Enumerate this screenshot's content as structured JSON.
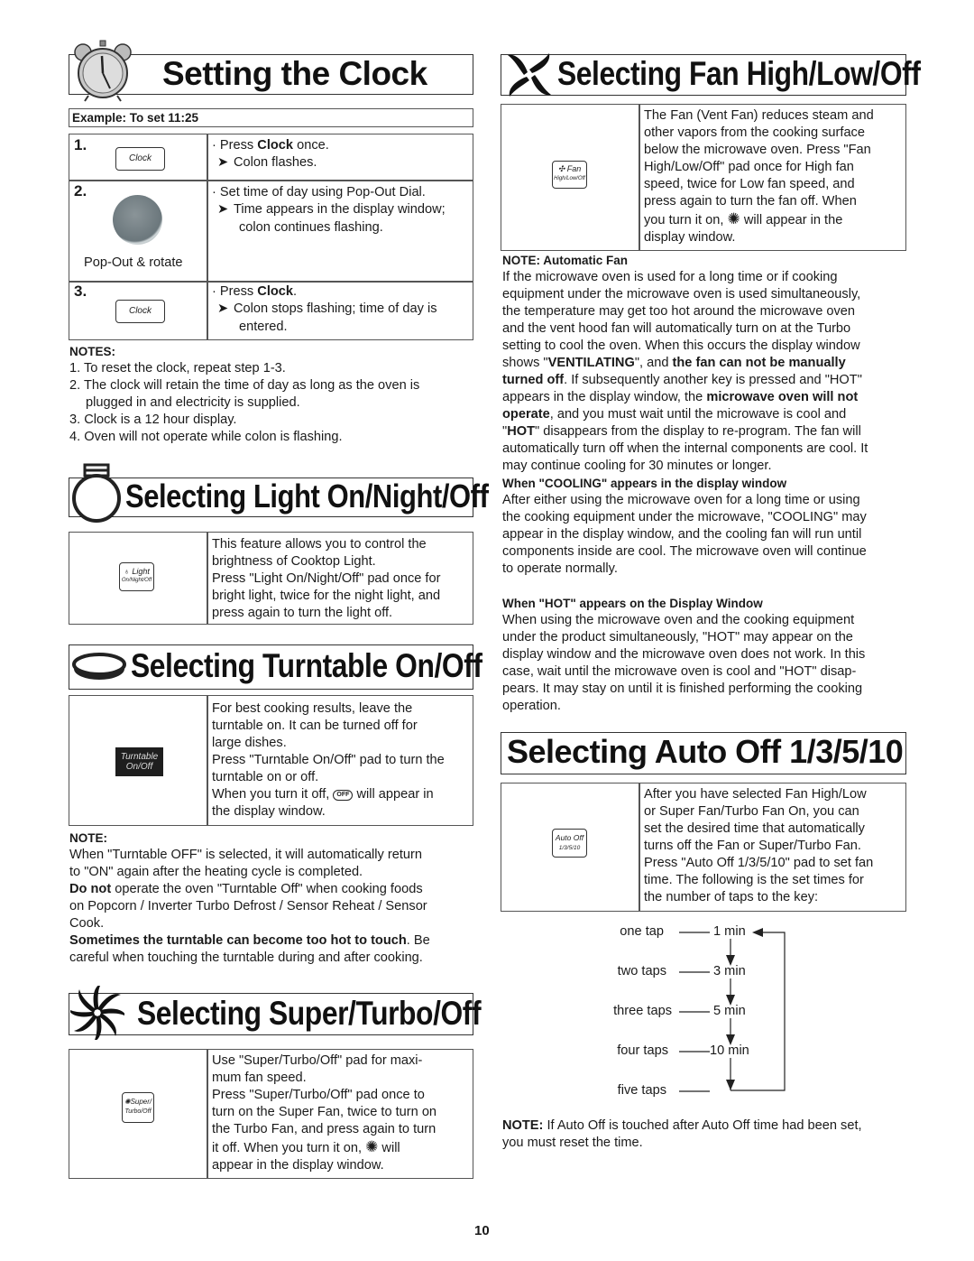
{
  "page_number": "10",
  "clock": {
    "title": "Setting the Clock",
    "icon": "alarm-clock-icon",
    "example": "Example: To set 11:25",
    "steps": [
      {
        "num": "1.",
        "pad": "Clock",
        "bullet_pre": "Press ",
        "bullet_bold": "Clock",
        "bullet_post": " once.",
        "result": [
          "Colon flashes."
        ]
      },
      {
        "num": "2.",
        "dial_label": "Pop-Out & rotate",
        "bullet_pre": "Set time of day using Pop-Out Dial.",
        "bullet_bold": "",
        "bullet_post": "",
        "result": [
          "Time appears in the display window;",
          "colon continues flashing."
        ]
      },
      {
        "num": "3.",
        "pad": "Clock",
        "bullet_pre": "Press ",
        "bullet_bold": "Clock",
        "bullet_post": ".",
        "result": [
          "Colon stops flashing; time of day is",
          "entered."
        ]
      }
    ],
    "notes_heading": "NOTES:",
    "notes": [
      "1. To reset the clock, repeat step 1-3.",
      "2. The clock will retain the time of day as long as the oven is",
      "plugged in and electricity is supplied.",
      "3. Clock is a 12 hour display.",
      "4. Oven will not operate while colon is flashing."
    ]
  },
  "light": {
    "title": "Selecting Light On/Night/Off",
    "icon": "light-bulb-icon",
    "pad_line1": "Light",
    "pad_line2": "On/Night/Off",
    "text": [
      "This feature allows you to control the",
      "brightness of Cooktop Light.",
      "Press \"Light On/Night/Off\" pad once for",
      "bright light, twice for the night light, and",
      "press again to turn the light off."
    ]
  },
  "turntable": {
    "title": "Selecting Turntable On/Off",
    "icon": "turntable-icon",
    "pad_line1": "Turntable",
    "pad_line2": "On/Off",
    "text": [
      "For best cooking results, leave the",
      "turntable on. It can be turned off for",
      "large dishes.",
      "Press \"Turntable On/Off\" pad to turn the",
      "turntable on or off."
    ],
    "text_off_pre": "When you turn it off,",
    "text_off_post": "will appear in",
    "text_off_last": "the display window.",
    "off_glyph": "OFF",
    "note_heading": "NOTE:",
    "note_lines": [
      "When \"Turntable OFF\" is selected, it will automatically return",
      "to \"ON\" again after the heating cycle is completed."
    ],
    "donot_bold": "Do not",
    "donot_rest": " operate the oven \"Turntable Off\" when cooking foods",
    "donot_lines": [
      "on Popcorn / Inverter Turbo Defrost / Sensor Reheat / Sensor",
      "Cook."
    ],
    "hot_bold": "Sometimes the turntable can become too hot to touch",
    "hot_rest": ". Be",
    "hot_last": "careful when touching the turntable during and after cooking."
  },
  "super_turbo": {
    "title": "Selecting Super/Turbo/Off",
    "icon": "turbo-fan-icon",
    "pad_line1": "Super/",
    "pad_line2": "Turbo/Off",
    "text": [
      "Use \"Super/Turbo/Off\" pad for maxi-",
      "mum fan speed.",
      "Press \"Super/Turbo/Off\" pad once to",
      "turn on the Super Fan, twice to turn on",
      "the Turbo Fan, and press again to turn"
    ],
    "text_on_pre": "it off. When you turn it on,",
    "text_on_post": "will",
    "text_last": "appear in the display window."
  },
  "fan": {
    "title": "Selecting Fan High/Low/Off",
    "icon": "fan-icon",
    "pad_line1": "Fan",
    "pad_line2": "High/Low/Off",
    "text": [
      "The Fan (Vent Fan) reduces steam and",
      "other vapors from the cooking surface",
      "below the microwave oven. Press \"Fan",
      "High/Low/Off\" pad once for High fan",
      "speed, twice for Low fan speed, and",
      "press again to turn the fan off. When"
    ],
    "text_on_pre": "you turn it on,",
    "text_on_post": "will appear in the",
    "text_last": "display window.",
    "auto_fan": {
      "heading": "NOTE: Automatic Fan",
      "lines": [
        "If the microwave oven is used for a long time or if cooking",
        "equipment under the microwave oven is used simultaneously,",
        "the temperature may get too hot around the microwave oven",
        "and the vent hood fan will automatically turn on at the Turbo",
        "setting to cool the oven. When this occurs the display window"
      ],
      "l6_a": "shows \"",
      "l6_b": "VENTILATING",
      "l6_c": "\", and ",
      "l6_d": "the fan can not be manually",
      "l7_a": "turned off",
      "l7_b": ". If subsequently another key is pressed and \"HOT\"",
      "l8_a": "appears in the display window, the ",
      "l8_b": "microwave oven will not",
      "l9_a": "operate",
      "l9_b": ", and you must wait until the microwave is cool and",
      "l10_a": "\"",
      "l10_b": "HOT",
      "l10_c": "\" disappears from the display to re-program. The fan will",
      "tail": [
        "automatically turn off when the internal components are cool. It",
        "may continue cooling for 30 minutes or longer."
      ]
    },
    "cooling": {
      "heading": "When \"COOLING\" appears in the display window",
      "lines": [
        "After either using the microwave oven for a long time or using",
        "the cooking equipment under the microwave, \"COOLING\" may",
        "appear in the display window, and the cooling fan will run until",
        "components inside are cool. The microwave oven will continue",
        "to operate normally."
      ]
    },
    "hot": {
      "heading": "When \"HOT\" appears on the Display Window",
      "lines": [
        "When using the microwave oven and the cooking equipment",
        "under the product simultaneously, \"HOT\" may appear on the",
        "display window and the microwave oven does not work. In this",
        "case, wait until the microwave oven is cool and \"HOT\" disap-",
        "pears. It may stay on until it is finished performing the cooking",
        "operation."
      ]
    }
  },
  "auto_off": {
    "title": "Selecting Auto Off 1/3/5/10",
    "pad_line1": "Auto Off",
    "pad_line2": "1/3/5/10",
    "text": [
      "After you have selected Fan High/Low",
      "or Super Fan/Turbo Fan On, you can",
      "set the desired time that automatically",
      "turns off the Fan or Super/Turbo Fan.",
      "Press \"Auto Off 1/3/5/10\" pad to set fan",
      "time. The following is the set times for",
      "the number of taps to the key:"
    ],
    "taps": [
      {
        "label": "one tap",
        "time": "1 min"
      },
      {
        "label": "two taps",
        "time": "3 min"
      },
      {
        "label": "three taps",
        "time": "5 min"
      },
      {
        "label": "four taps",
        "time": "10 min"
      },
      {
        "label": "five taps",
        "time": ""
      }
    ],
    "note_bold": "NOTE:",
    "note_rest": " If Auto Off is touched after Auto Off time had been set,",
    "note_last": "you must reset the time."
  }
}
